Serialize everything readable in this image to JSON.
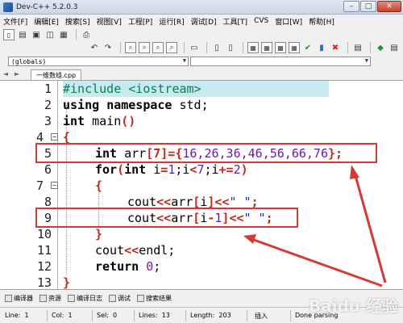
{
  "window": {
    "title": "Dev-C++ 5.2.0.3",
    "minimize": "–",
    "maximize": "□",
    "close": "✕"
  },
  "menu": [
    "文件[F]",
    "编辑[E]",
    "搜索[S]",
    "视图[V]",
    "工程[P]",
    "运行[R]",
    "调试[D]",
    "工具[T]",
    "CVS",
    "窗口[W]",
    "帮助[H]"
  ],
  "combos": {
    "scope": "(globals)",
    "symbol": ""
  },
  "tab": {
    "label": "一维数组.cpp",
    "nav_left": "◄",
    "nav_right": "►"
  },
  "code_lines": [
    {
      "n": "1"
    },
    {
      "n": "2"
    },
    {
      "n": "3"
    },
    {
      "n": "4"
    },
    {
      "n": "5"
    },
    {
      "n": "6"
    },
    {
      "n": "7"
    },
    {
      "n": "8"
    },
    {
      "n": "9"
    },
    {
      "n": "10"
    },
    {
      "n": "11"
    },
    {
      "n": "12"
    },
    {
      "n": "13"
    }
  ],
  "code": {
    "l1": "#include <iostream>",
    "l2_kw1": "using",
    "l2_kw2": "namespace",
    "l2_rest": " std;",
    "l3_kw": "int",
    "l3_rest": " main",
    "l3_paren": "()",
    "l4": "{",
    "l5_kw": "int",
    "l5_a": " arr",
    "l5_b": "[7]={",
    "l5_nums": "16,26,36,46,56,66,76",
    "l5_c": "};",
    "l6_kw": "for",
    "l6_a": "(",
    "l6_kw2": "int",
    "l6_b": " i",
    "l6_c": "=",
    "l6_d": "1",
    "l6_e": ";i",
    "l6_f": "<",
    "l6_g": "7",
    "l6_h": ";i",
    "l6_i": "+=",
    "l6_j": "2",
    "l6_k": ")",
    "l7": "{",
    "l8_a": "cout",
    "l8_b": "<<",
    "l8_c": "arr",
    "l8_d": "[",
    "l8_e": "i",
    "l8_f": "]",
    "l8_g": "<<",
    "l8_h": "\" \"",
    "l8_i": ";",
    "l9_a": "cout",
    "l9_b": "<<",
    "l9_c": "arr",
    "l9_d": "[",
    "l9_e": "i",
    "l9_f": "-",
    "l9_g": "1",
    "l9_h": "]",
    "l9_i": "<<",
    "l9_j": "\" \"",
    "l9_k": ";",
    "l10": "}",
    "l11_a": "cout",
    "l11_b": "<<",
    "l11_c": "endl;",
    "l12_kw": "return",
    "l12_num": " 0",
    "l12_rest": ";",
    "l13": "}"
  },
  "fold_markers": {
    "l4": "−",
    "l7": "−"
  },
  "bottom_tabs": [
    "编译器",
    "资源",
    "编译日志",
    "调试",
    "搜索结果"
  ],
  "status": {
    "line_label": "Line:",
    "line": "1",
    "col_label": "Col:",
    "col": "1",
    "sel_label": "Sel:",
    "sel": "0",
    "lines_label": "Lines:",
    "lines": "13",
    "length_label": "Length:",
    "length": "203",
    "mode": "插入",
    "parse": "Done parsing"
  },
  "watermark": "Baidu 经验",
  "colors": {
    "annotation": "#d43a32",
    "current_line": "#c6eaf0",
    "keyword": "#000000",
    "operator": "#c2281c",
    "number": "#6a18b0",
    "string": "#1a2fc8",
    "preprocessor": "#0b7f53"
  }
}
